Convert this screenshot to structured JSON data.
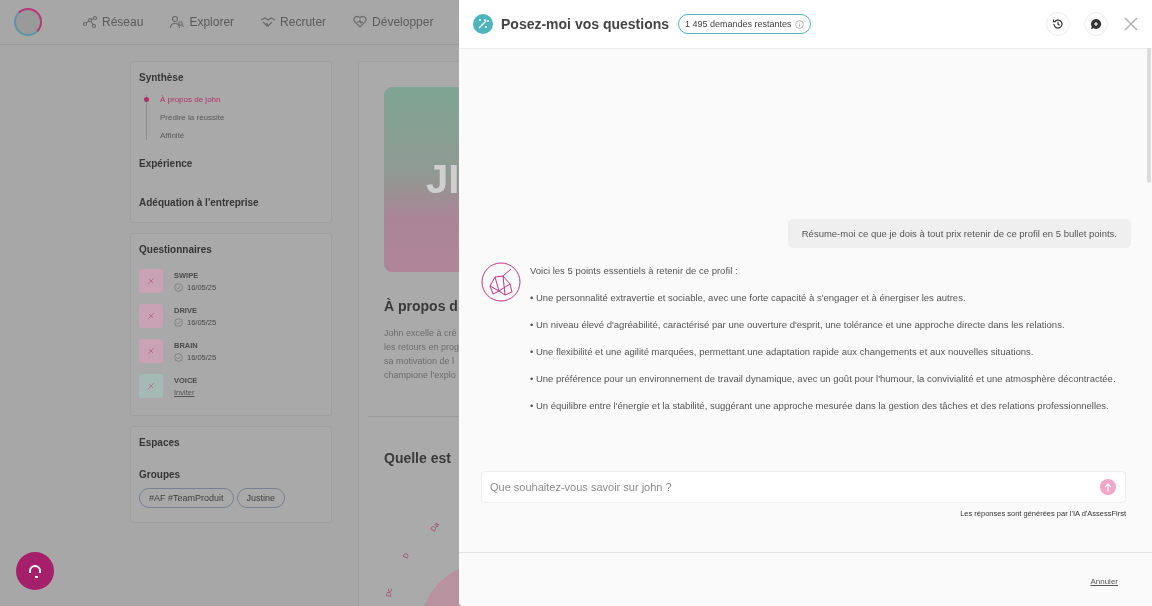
{
  "nav": {
    "items": [
      {
        "label": "Réseau"
      },
      {
        "label": "Explorer"
      },
      {
        "label": "Recruter"
      },
      {
        "label": "Développer"
      }
    ]
  },
  "sidebar": {
    "summary": {
      "title": "Synthèse",
      "children": [
        {
          "label": "À propos de john",
          "selected": true
        },
        {
          "label": "Prédire la réussite",
          "selected": false
        },
        {
          "label": "Affinité",
          "selected": false
        }
      ]
    },
    "sections": [
      "Expérience",
      "Adéquation à l'entreprise"
    ],
    "questionnaires": {
      "title": "Questionnaires",
      "items": [
        {
          "name": "SWIPE",
          "kind": "done",
          "date": "16/05/25",
          "color": "#c9a3b4"
        },
        {
          "name": "DRIVE",
          "kind": "done",
          "date": "16/05/25",
          "color": "#c9a3b4"
        },
        {
          "name": "BRAIN",
          "kind": "done",
          "date": "16/05/25",
          "color": "#c9a3b4"
        },
        {
          "name": "VOICE",
          "kind": "invite",
          "action": "Inviter",
          "color": "#a5b9b5"
        }
      ]
    },
    "spaces": {
      "title": "Espaces"
    },
    "groups": {
      "title": "Groupes",
      "tags": [
        "#AF #TeamProduit",
        "Justine"
      ]
    }
  },
  "profile": {
    "banner_text": "JI",
    "heading": "À propos d",
    "paragraph_lines": [
      "John excelle à cré",
      "les retours en prog",
      "sa motivation de l",
      "champione l'explo"
    ],
    "section_heading": "Quelle est",
    "chart_labels": [
      "Da",
      "D",
      "Dc"
    ]
  },
  "chat": {
    "title": "Posez-moi vos questions",
    "quota": "1 495 demandes restantes",
    "messages": [
      {
        "kind": "user",
        "text": "Résume-moi ce que je dois à tout prix retenir de ce profil en 5 bullet points."
      },
      {
        "kind": "assistant",
        "intro": "Voici les 5 points essentiels à retenir de ce profil :",
        "points": [
          "• Une personnalité extravertie et sociable, avec une forte capacité à s'engager et à énergiser les autres.",
          "• Un niveau élevé d'agréabilité, caractérisé par une ouverture d'esprit, une tolérance et une approche directe dans les relations.",
          "• Une flexibilité et une agilité marquées, permettant une adaptation rapide aux changements et aux nouvelles situations.",
          "• Une préférence pour un environnement de travail dynamique, avec un goût pour l'humour, la convivialité et une atmosphère décontractée.",
          "• Un équilibre entre l'énergie et la stabilité, suggérant une approche mesurée dans la gestion des tâches et des relations professionnelles."
        ]
      }
    ],
    "input": {
      "placeholder": "Que souhaitez-vous savoir sur john ?"
    },
    "disclaimer": "Les réponses sont générées par l'IA d'AssessFirst",
    "cancel": "Annuler"
  }
}
